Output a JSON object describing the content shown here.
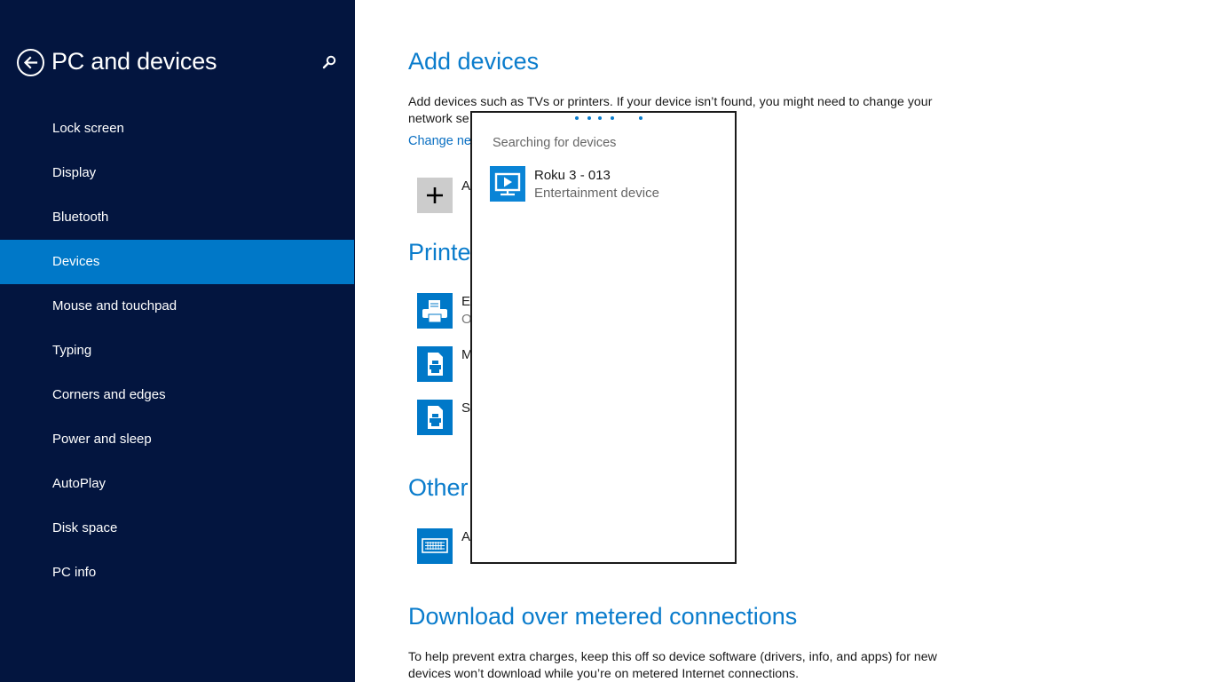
{
  "sidebar": {
    "title": "PC and devices",
    "back_icon": "back-arrow-circle-icon",
    "search_icon": "search-icon",
    "items": [
      {
        "label": "Lock screen",
        "selected": false
      },
      {
        "label": "Display",
        "selected": false
      },
      {
        "label": "Bluetooth",
        "selected": false
      },
      {
        "label": "Devices",
        "selected": true
      },
      {
        "label": "Mouse and touchpad",
        "selected": false
      },
      {
        "label": "Typing",
        "selected": false
      },
      {
        "label": "Corners and edges",
        "selected": false
      },
      {
        "label": "Power and sleep",
        "selected": false
      },
      {
        "label": "AutoPlay",
        "selected": false
      },
      {
        "label": "Disk space",
        "selected": false
      },
      {
        "label": "PC info",
        "selected": false
      }
    ]
  },
  "main": {
    "add_devices": {
      "heading": "Add devices",
      "description_line1": "Add devices such as TVs or printers. If your device isn’t found, you might need to change your",
      "description_line2": "network se",
      "link": "Change ne",
      "add_button_label": "A",
      "add_icon": "plus-icon"
    },
    "printers": {
      "heading": "Printer",
      "items": [
        {
          "icon": "printer-icon",
          "label": "E",
          "sub": "O"
        },
        {
          "icon": "document-printer-icon",
          "label": "M",
          "sub": ""
        },
        {
          "icon": "document-printer-icon",
          "label": "S",
          "sub": ""
        }
      ]
    },
    "other": {
      "heading": "Other",
      "items": [
        {
          "icon": "keyboard-icon",
          "label": "A"
        }
      ]
    },
    "metered": {
      "heading": "Download over metered connections",
      "description_line1": "To help prevent extra charges, keep this off so device software (drivers, info, and apps) for new",
      "description_line2": "devices won’t download while you’re on metered Internet connections."
    }
  },
  "flyout": {
    "status": "Searching for devices",
    "progress_indicator": "indeterminate-dots",
    "devices": [
      {
        "name": "Roku 3 - 013",
        "type": "Entertainment device",
        "icon": "media-display-icon"
      }
    ]
  },
  "colors": {
    "sidebar_bg": "#03153f",
    "selected_bg": "#0078c8",
    "accent": "#0a7ccc"
  }
}
